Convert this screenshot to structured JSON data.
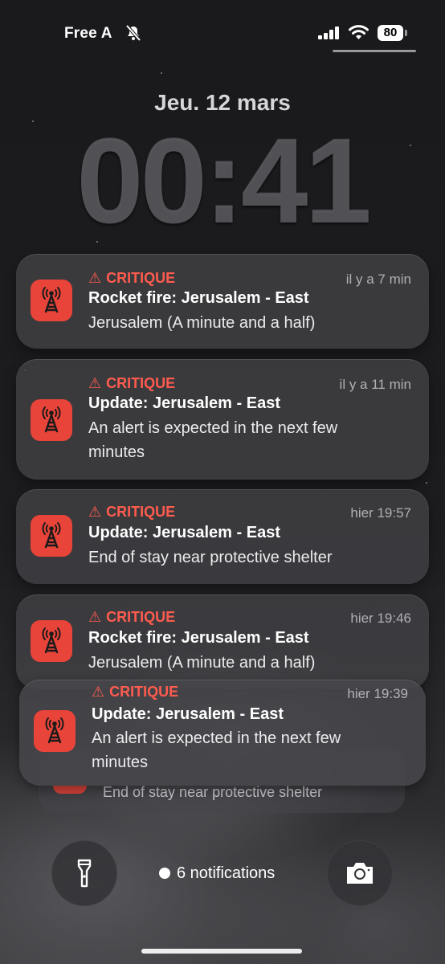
{
  "status_bar": {
    "carrier": "Free A",
    "battery": "80"
  },
  "lock": {
    "date": "Jeu. 12 mars",
    "time": "00:41"
  },
  "notifications": [
    {
      "tag": "CRITIQUE",
      "time": "il y a 7 min",
      "title": "Rocket fire: Jerusalem - East",
      "body": "Jerusalem (A minute and a half)"
    },
    {
      "tag": "CRITIQUE",
      "time": "il y a 11 min",
      "title": "Update: Jerusalem - East",
      "body": "An alert is expected in the next few minutes"
    },
    {
      "tag": "CRITIQUE",
      "time": "hier 19:57",
      "title": "Update: Jerusalem - East",
      "body": "End of stay near protective shelter"
    },
    {
      "tag": "CRITIQUE",
      "time": "hier 19:46",
      "title": "Rocket fire: Jerusalem - East",
      "body": "Jerusalem (A minute and a half)"
    },
    {
      "tag": "CRITIQUE",
      "time": "hier 19:39",
      "title": "Update: Jerusalem - East",
      "body": "An alert is expected in the next few minutes"
    }
  ],
  "stack_peek": {
    "body": "End of stay near protective shelter"
  },
  "bottom": {
    "notification_count": "6 notifications"
  },
  "colors": {
    "accent_red": "#ff5b4e",
    "app_icon_red": "#e8443a"
  },
  "icons": [
    "bell-slash-icon",
    "signal-icon",
    "wifi-icon",
    "battery-icon",
    "warning-icon",
    "radio-tower-icon",
    "flashlight-icon",
    "camera-icon"
  ]
}
